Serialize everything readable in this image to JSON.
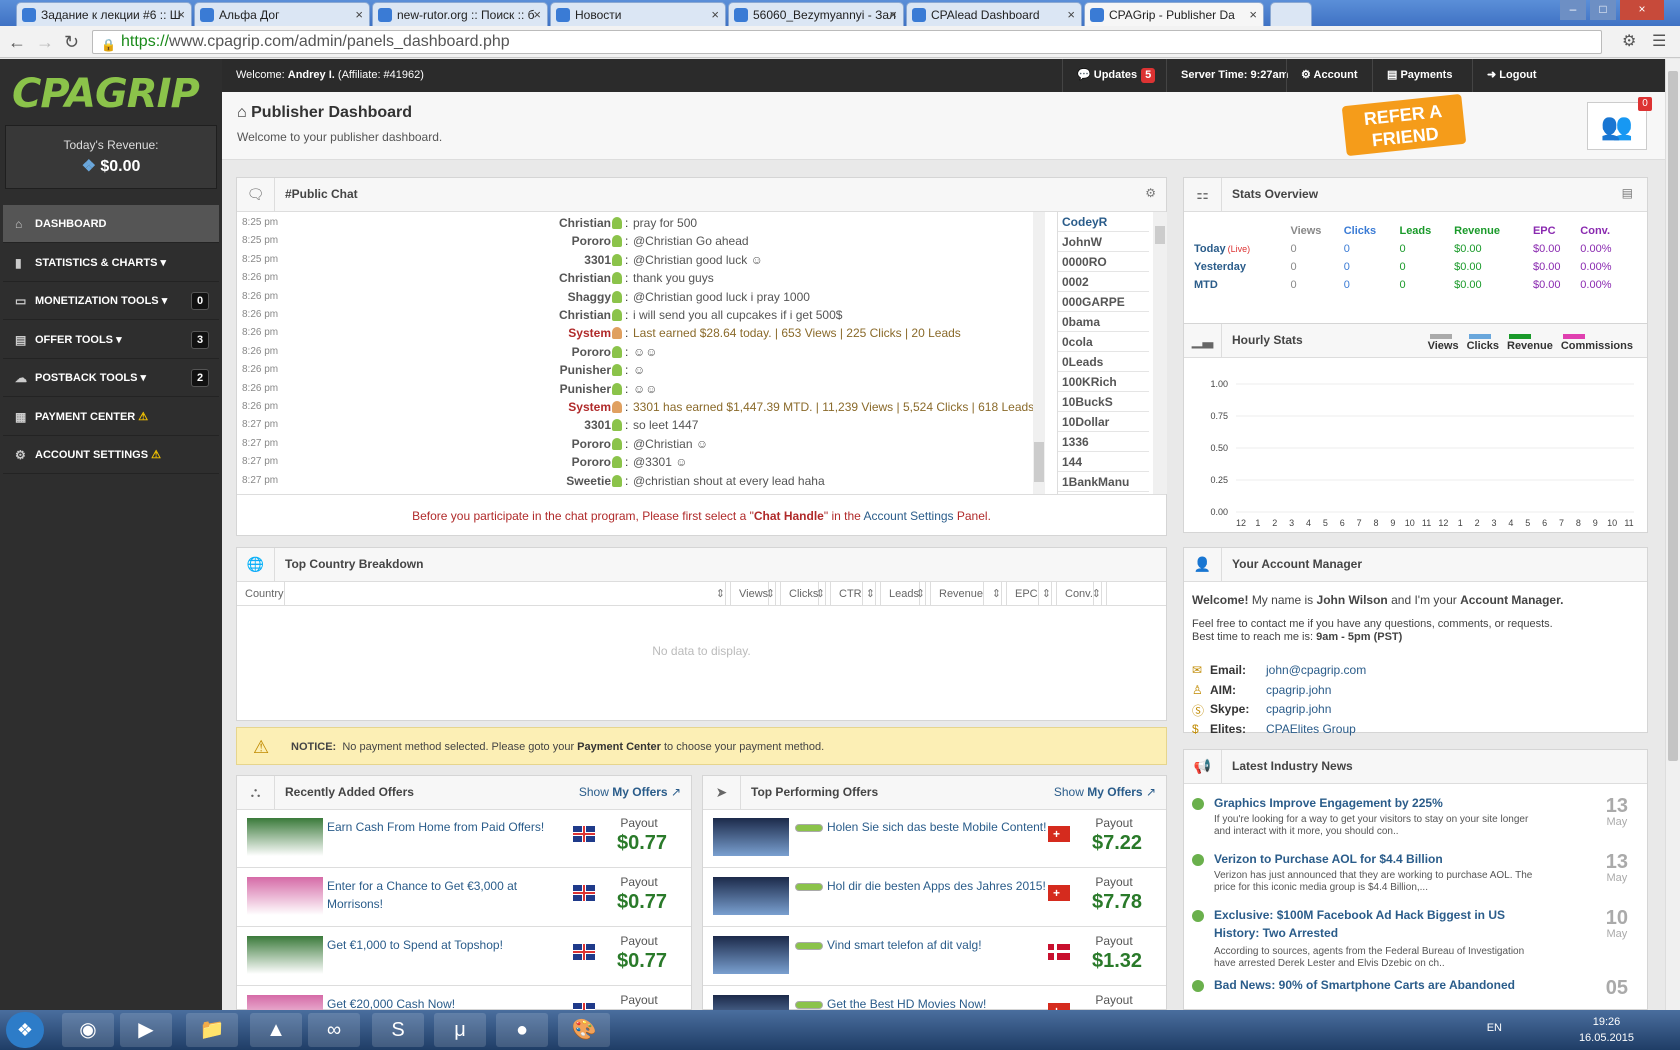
{
  "browser": {
    "tabs": [
      {
        "title": "Задание к лекции #6 :: Ш",
        "active": false
      },
      {
        "title": "Альфа Дог",
        "active": false
      },
      {
        "title": "new-rutor.org :: Поиск :: б",
        "active": false
      },
      {
        "title": "Новости",
        "active": false
      },
      {
        "title": "56060_Bezymyannyi - Зал",
        "active": false
      },
      {
        "title": "CPAlead Dashboard",
        "active": false
      },
      {
        "title": "CPAGrip - Publisher Da",
        "active": true
      }
    ],
    "url_scheme": "https://",
    "url_rest": "www.cpagrip.com/admin/panels_dashboard.php"
  },
  "sidebar": {
    "logo": "CPAGRIP",
    "revenue_label": "Today's Revenue:",
    "revenue_value": "$0.00",
    "items": [
      {
        "label": "DASHBOARD",
        "icon": "home-icon",
        "count": "",
        "warn": false
      },
      {
        "label": "STATISTICS & CHARTS",
        "icon": "bar-chart-icon",
        "count": "",
        "warn": false
      },
      {
        "label": "MONETIZATION TOOLS",
        "icon": "monitor-icon",
        "count": "0",
        "warn": false
      },
      {
        "label": "OFFER TOOLS",
        "icon": "clipboard-icon",
        "count": "3",
        "warn": false
      },
      {
        "label": "POSTBACK TOOLS",
        "icon": "cloud-icon",
        "count": "2",
        "warn": false
      },
      {
        "label": "PAYMENT CENTER",
        "icon": "money-icon",
        "count": "",
        "warn": true
      },
      {
        "label": "ACCOUNT SETTINGS",
        "icon": "gear-icon",
        "count": "",
        "warn": true
      }
    ]
  },
  "topbar": {
    "welcome_prefix": "Welcome:",
    "welcome_name": "Andrey I.",
    "affiliate": "(Affiliate: #41962)",
    "updates_label": "Updates",
    "updates_count": "5",
    "server_time": "Server Time: 9:27am",
    "account": "Account",
    "payments": "Payments",
    "logout": "Logout"
  },
  "header": {
    "title": "Publisher Dashboard",
    "subtitle": "Welcome to your publisher dashboard.",
    "refer": "REFER A FRIEND",
    "friends_count": "0"
  },
  "chat": {
    "title": "#Public Chat",
    "messages": [
      {
        "time": "8:25 pm",
        "user": "Christian",
        "text": "pray for 500"
      },
      {
        "time": "8:25 pm",
        "user": "Pororo",
        "text": "@Christian Go ahead"
      },
      {
        "time": "8:25 pm",
        "user": "3301",
        "text": "@Christian good luck ☺"
      },
      {
        "time": "8:26 pm",
        "user": "Christian",
        "text": "thank you guys"
      },
      {
        "time": "8:26 pm",
        "user": "Shaggy",
        "text": "@Christian good luck i pray 1000"
      },
      {
        "time": "8:26 pm",
        "user": "Christian",
        "text": "i will send you all cupcakes if i get 500$"
      },
      {
        "time": "8:26 pm",
        "user": "System",
        "text": "Last earned $28.64 today. | 653 Views | 225 Clicks | 20 Leads"
      },
      {
        "time": "8:26 pm",
        "user": "Pororo",
        "text": "☺☺"
      },
      {
        "time": "8:26 pm",
        "user": "Punisher",
        "text": "☺"
      },
      {
        "time": "8:26 pm",
        "user": "Punisher",
        "text": "☺☺"
      },
      {
        "time": "8:26 pm",
        "user": "System",
        "text": "3301 has earned $1,447.39 MTD. | 11,239 Views | 5,524 Clicks | 618 Leads"
      },
      {
        "time": "8:27 pm",
        "user": "3301",
        "text": "so leet 1447"
      },
      {
        "time": "8:27 pm",
        "user": "Pororo",
        "text": "@Christian ☺"
      },
      {
        "time": "8:27 pm",
        "user": "Pororo",
        "text": "@3301 ☺"
      },
      {
        "time": "8:27 pm",
        "user": "Sweetie",
        "text": "@christian shout at every lead haha"
      }
    ],
    "users": [
      "CodeyR",
      "JohnW",
      "0000RO",
      "0002",
      "000GARPE",
      "0bama",
      "0cola",
      "0Leads",
      "100KRich",
      "10BuckS",
      "10Dollar",
      "1336",
      "144",
      "1BankManu"
    ],
    "notice_pre": "Before you participate in the chat program, Please first select a \"",
    "notice_handle": "Chat Handle",
    "notice_mid": "\" in the ",
    "notice_link": "Account Settings",
    "notice_post": " Panel."
  },
  "stats_overview": {
    "title": "Stats Overview",
    "headers": [
      "",
      "Views",
      "Clicks",
      "Leads",
      "Revenue",
      "EPC",
      "Conv."
    ],
    "rows": [
      {
        "label": "Today",
        "live": "(Live)",
        "views": "0",
        "clicks": "0",
        "leads": "0",
        "revenue": "$0.00",
        "epc": "$0.00",
        "conv": "0.00%"
      },
      {
        "label": "Yesterday",
        "live": "",
        "views": "0",
        "clicks": "0",
        "leads": "0",
        "revenue": "$0.00",
        "epc": "$0.00",
        "conv": "0.00%"
      },
      {
        "label": "MTD",
        "live": "",
        "views": "0",
        "clicks": "0",
        "leads": "0",
        "revenue": "$0.00",
        "epc": "$0.00",
        "conv": "0.00%"
      }
    ]
  },
  "hourly": {
    "title": "Hourly Stats",
    "legend": [
      {
        "name": "Views",
        "color": "#aaaaaa"
      },
      {
        "name": "Clicks",
        "color": "#6aa7dc"
      },
      {
        "name": "Revenue",
        "color": "#1a9a2a"
      },
      {
        "name": "Commissions",
        "color": "#e040b0"
      }
    ]
  },
  "chart_data": {
    "type": "line",
    "title": "Hourly Stats",
    "x": [
      "12 am",
      "1 am",
      "2 am",
      "3 am",
      "4 am",
      "5 am",
      "6 am",
      "7 am",
      "8 am",
      "9 am",
      "10 am",
      "11 am",
      "12 pm",
      "1 pm",
      "2 pm",
      "3 pm",
      "4 pm",
      "5 pm",
      "6 pm",
      "7 pm",
      "8 pm",
      "9 pm",
      "10 pm",
      "11 pm"
    ],
    "ylim": [
      0,
      1
    ],
    "yticks": [
      "0.00",
      "0.25",
      "0.50",
      "0.75",
      "1.00"
    ],
    "series": [
      {
        "name": "Views",
        "values": [
          0,
          0,
          0,
          0,
          0,
          0,
          0,
          0,
          0,
          0,
          0,
          0,
          0,
          0,
          0,
          0,
          0,
          0,
          0,
          0,
          0,
          0,
          0,
          0
        ]
      },
      {
        "name": "Clicks",
        "values": [
          0,
          0,
          0,
          0,
          0,
          0,
          0,
          0,
          0,
          0,
          0,
          0,
          0,
          0,
          0,
          0,
          0,
          0,
          0,
          0,
          0,
          0,
          0,
          0
        ]
      },
      {
        "name": "Revenue",
        "values": [
          0,
          0,
          0,
          0,
          0,
          0,
          0,
          0,
          0,
          0,
          0,
          0,
          0,
          0,
          0,
          0,
          0,
          0,
          0,
          0,
          0,
          0,
          0,
          0
        ]
      },
      {
        "name": "Commissions",
        "values": [
          0,
          0,
          0,
          0,
          0,
          0,
          0,
          0,
          0,
          0,
          0,
          0,
          0,
          0,
          0,
          0,
          0,
          0,
          0,
          0,
          0,
          0,
          0,
          0
        ]
      }
    ]
  },
  "country": {
    "title": "Top Country Breakdown",
    "columns": [
      "Country",
      "Views",
      "Clicks",
      "CTR",
      "Leads",
      "Revenue",
      "EPC",
      "Conv."
    ],
    "empty": "No data to display."
  },
  "notice": {
    "label": "NOTICE:",
    "pre": "No payment method selected. Please goto your",
    "link": "Payment Center",
    "post": "to choose your payment method."
  },
  "recent_offers": {
    "title": "Recently Added Offers",
    "show_prefix": "Show",
    "show_link": "My Offers",
    "items": [
      {
        "title": "Earn Cash From Home from Paid Offers!",
        "payout_label": "Payout",
        "payout": "$0.77",
        "flag": "uk"
      },
      {
        "title": "Enter for a Chance to Get €3,000 at Morrisons!",
        "payout_label": "Payout",
        "payout": "$0.77",
        "flag": "uk"
      },
      {
        "title": "Get €1,000 to Spend at Topshop!",
        "payout_label": "Payout",
        "payout": "$0.77",
        "flag": "uk"
      },
      {
        "title": "Get €20,000 Cash Now!",
        "payout_label": "Payout",
        "payout": "",
        "flag": "uk"
      }
    ]
  },
  "top_offers": {
    "title": "Top Performing Offers",
    "show_prefix": "Show",
    "show_link": "My Offers",
    "items": [
      {
        "title": "Holen Sie sich das beste Mobile Content!",
        "payout_label": "Payout",
        "payout": "$7.22",
        "flag": "ch"
      },
      {
        "title": "Hol dir die besten Apps des Jahres 2015!",
        "payout_label": "Payout",
        "payout": "$7.78",
        "flag": "ch"
      },
      {
        "title": "Vind smart telefon af dit valg!",
        "payout_label": "Payout",
        "payout": "$1.32",
        "flag": "dk"
      },
      {
        "title": "Get the Best HD Movies Now!",
        "payout_label": "Payout",
        "payout": "",
        "flag": "ch"
      }
    ]
  },
  "manager": {
    "title": "Your Account Manager",
    "welcome": "Welcome!",
    "intro_pre": "My name is",
    "name": "John Wilson",
    "intro_mid": "and I'm your",
    "role": "Account Manager.",
    "contact_text": "Feel free to contact me if you have any questions, comments, or requests.",
    "hours_pre": "Best time to reach me is:",
    "hours": "9am - 5pm (PST)",
    "contacts": [
      {
        "key": "Email:",
        "value": "john@cpagrip.com",
        "icon": "envelope-icon"
      },
      {
        "key": "AIM:",
        "value": "cpagrip.john",
        "icon": "aim-icon"
      },
      {
        "key": "Skype:",
        "value": "cpagrip.john",
        "icon": "skype-icon"
      },
      {
        "key": "Elites:",
        "value": "CPAElites Group",
        "icon": "moneybag-icon"
      }
    ]
  },
  "news": {
    "title": "Latest Industry News",
    "items": [
      {
        "headline": "Graphics Improve Engagement by 225%",
        "summary": "If you're looking for a way to get your visitors to stay on your site longer and interact with it more, you should con..",
        "day": "13",
        "month": "May"
      },
      {
        "headline": "Verizon to Purchase AOL for $4.4 Billion",
        "summary": "Verizon has just announced that they are working to purchase AOL. The price for this iconic media group is $4.4 Billion,...",
        "day": "13",
        "month": "May"
      },
      {
        "headline": "Exclusive: $100M Facebook Ad Hack Biggest in US History: Two Arrested",
        "summary": "According to sources, agents from the Federal Bureau of Investigation have arrested Derek Lester and Elvis Dzebic on ch..",
        "day": "10",
        "month": "May"
      },
      {
        "headline": "Bad News: 90% of Smartphone Carts are Abandoned",
        "summary": "",
        "day": "05",
        "month": ""
      }
    ]
  },
  "taskbar": {
    "lang": "EN",
    "time": "19:26",
    "date": "16.05.2015"
  }
}
